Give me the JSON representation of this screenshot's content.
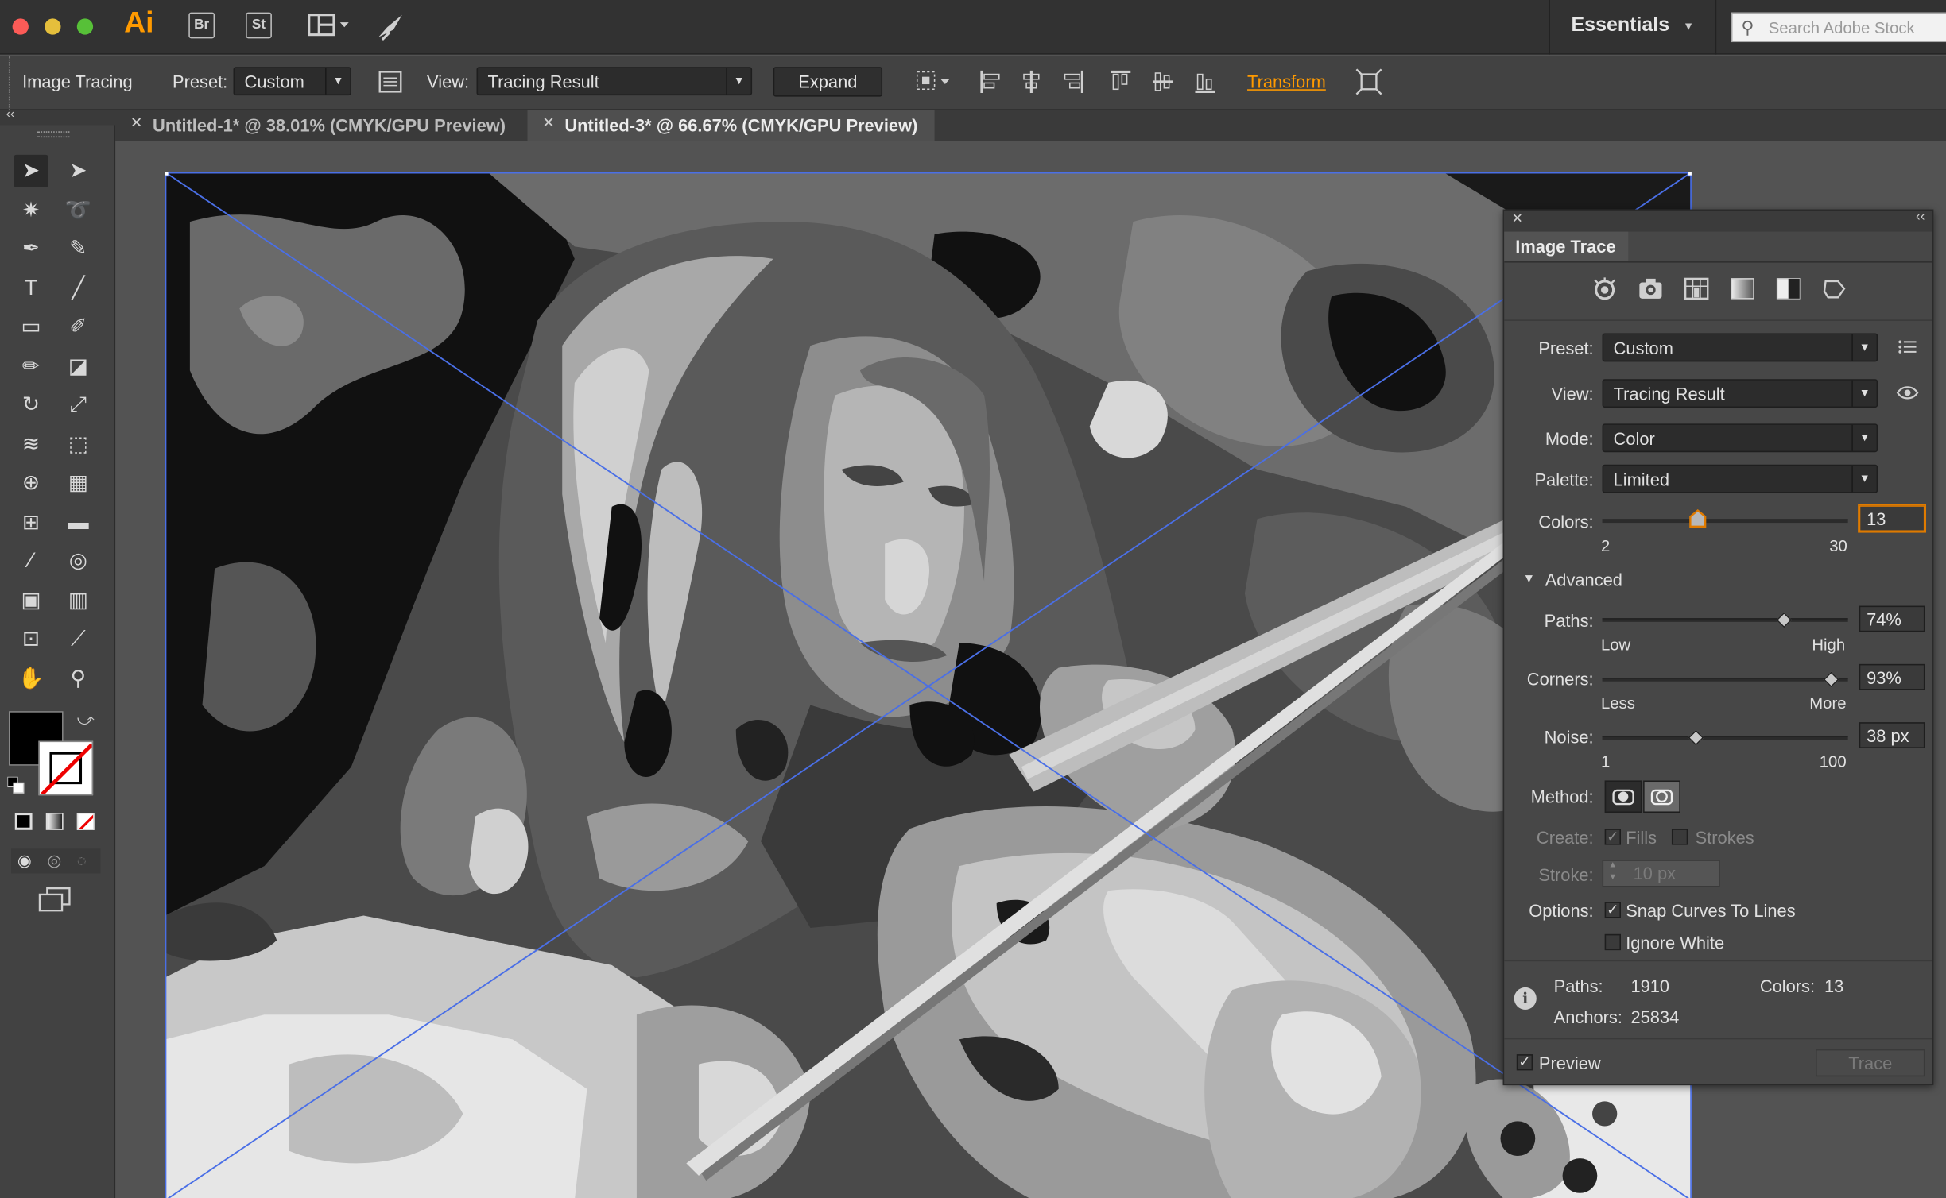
{
  "appbar": {
    "app_logo": "Ai",
    "bridge_label": "Br",
    "stock_label": "St",
    "workspace_label": "Essentials",
    "search_placeholder": "Search Adobe Stock"
  },
  "control_bar": {
    "mode_label": "Image Tracing",
    "preset_label": "Preset:",
    "preset_value": "Custom",
    "view_label": "View:",
    "view_value": "Tracing Result",
    "expand_label": "Expand",
    "transform_label": "Transform"
  },
  "tabs": [
    {
      "label": "Untitled-1* @ 38.01% (CMYK/GPU Preview)",
      "active": false
    },
    {
      "label": "Untitled-3* @ 66.67% (CMYK/GPU Preview)",
      "active": true
    }
  ],
  "tools": [
    {
      "name": "selection-tool",
      "glyph": "➤"
    },
    {
      "name": "direct-selection-tool",
      "glyph": "➤"
    },
    {
      "name": "magic-wand-tool",
      "glyph": "✷"
    },
    {
      "name": "lasso-tool",
      "glyph": "➰"
    },
    {
      "name": "pen-tool",
      "glyph": "✒"
    },
    {
      "name": "curvature-tool",
      "glyph": "✎"
    },
    {
      "name": "type-tool",
      "glyph": "T"
    },
    {
      "name": "line-tool",
      "glyph": "╱"
    },
    {
      "name": "rectangle-tool",
      "glyph": "▭"
    },
    {
      "name": "paintbrush-tool",
      "glyph": "✐"
    },
    {
      "name": "shaper-tool",
      "glyph": "✏"
    },
    {
      "name": "eraser-tool",
      "glyph": "◪"
    },
    {
      "name": "rotate-tool",
      "glyph": "↻"
    },
    {
      "name": "scale-tool",
      "glyph": "⤢"
    },
    {
      "name": "width-tool",
      "glyph": "≋"
    },
    {
      "name": "free-transform-tool",
      "glyph": "⬚"
    },
    {
      "name": "shape-builder-tool",
      "glyph": "⊕"
    },
    {
      "name": "perspective-grid-tool",
      "glyph": "▦"
    },
    {
      "name": "mesh-tool",
      "glyph": "⊞"
    },
    {
      "name": "gradient-tool",
      "glyph": "▬"
    },
    {
      "name": "eyedropper-tool",
      "glyph": "⁄"
    },
    {
      "name": "blend-tool",
      "glyph": "◎"
    },
    {
      "name": "symbol-sprayer-tool",
      "glyph": "▣"
    },
    {
      "name": "column-graph-tool",
      "glyph": "▥"
    },
    {
      "name": "artboard-tool",
      "glyph": "⊡"
    },
    {
      "name": "slice-tool",
      "glyph": "⟋"
    },
    {
      "name": "hand-tool",
      "glyph": "✋"
    },
    {
      "name": "zoom-tool",
      "glyph": "⚲"
    }
  ],
  "image_trace": {
    "title": "Image Trace",
    "preset_label": "Preset:",
    "preset_value": "Custom",
    "view_label": "View:",
    "view_value": "Tracing Result",
    "mode_label": "Mode:",
    "mode_value": "Color",
    "palette_label": "Palette:",
    "palette_value": "Limited",
    "colors_label": "Colors:",
    "colors_value": "13",
    "colors_min": "2",
    "colors_max": "30",
    "colors_fraction": 0.39,
    "advanced_label": "Advanced",
    "paths_label": "Paths:",
    "paths_value": "74%",
    "paths_low": "Low",
    "paths_high": "High",
    "paths_fraction": 0.74,
    "corners_label": "Corners:",
    "corners_value": "93%",
    "corners_less": "Less",
    "corners_more": "More",
    "corners_fraction": 0.93,
    "noise_label": "Noise:",
    "noise_value": "38 px",
    "noise_min": "1",
    "noise_max": "100",
    "noise_fraction": 0.38,
    "method_label": "Method:",
    "create_label": "Create:",
    "fills_label": "Fills",
    "strokes_label": "Strokes",
    "stroke_label": "Stroke:",
    "stroke_value": "10 px",
    "options_label": "Options:",
    "snap_label": "Snap Curves To Lines",
    "ignore_white_label": "Ignore White",
    "stats_paths_label": "Paths:",
    "stats_paths_value": "1910",
    "stats_colors_label": "Colors:",
    "stats_colors_value": "13",
    "stats_anchors_label": "Anchors:",
    "stats_anchors_value": "25834",
    "preview_label": "Preview",
    "trace_label": "Trace"
  },
  "colors": {
    "accent_orange": "#ff9a00",
    "selection_blue": "#4a6fe6",
    "traffic_red": "#fc5b57",
    "traffic_yellow": "#e5bf3c",
    "traffic_green": "#57c038"
  }
}
